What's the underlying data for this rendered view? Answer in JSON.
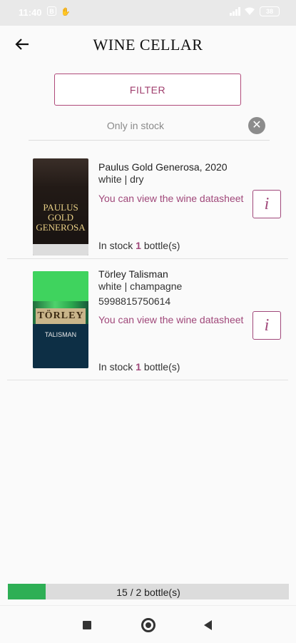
{
  "status_bar": {
    "time": "11:40",
    "icons": [
      "b-icon",
      "hand-icon",
      "signal-icon",
      "wifi-icon",
      "battery-icon"
    ],
    "battery": "38"
  },
  "app_bar": {
    "back_icon": "arrow-left-icon",
    "title": "WINE CELLAR"
  },
  "filter": {
    "button_label": "FILTER",
    "stock_filter_label": "Only in stock",
    "clear_icon": "close-circle-icon"
  },
  "wines": [
    {
      "name": "Paulus Gold Generosa, 2020",
      "type": "white | dry",
      "barcode": "",
      "datasheet_link": "You can view the wine datasheet",
      "stock_prefix": "In stock",
      "stock_count": "1",
      "stock_unit": "bottle(s)",
      "label_text": "PAULUS GOLD GENEROSA"
    },
    {
      "name": "Törley Talisman",
      "type": "white | champagne",
      "barcode": "5998815750614",
      "datasheet_link": "You can view the wine datasheet",
      "stock_prefix": "In stock",
      "stock_count": "1",
      "stock_unit": "bottle(s)",
      "label_text": "TÖRLEY",
      "label_subtext": "TALISMAN"
    }
  ],
  "progress": {
    "label": "15 / 2 bottle(s)",
    "fill_fraction": 0.135,
    "color": "#2eaf55"
  },
  "colors": {
    "accent": "#a0487a",
    "background": "#fafafa"
  },
  "nav": {
    "icons": [
      "recent-apps-icon",
      "home-icon",
      "back-icon"
    ]
  }
}
